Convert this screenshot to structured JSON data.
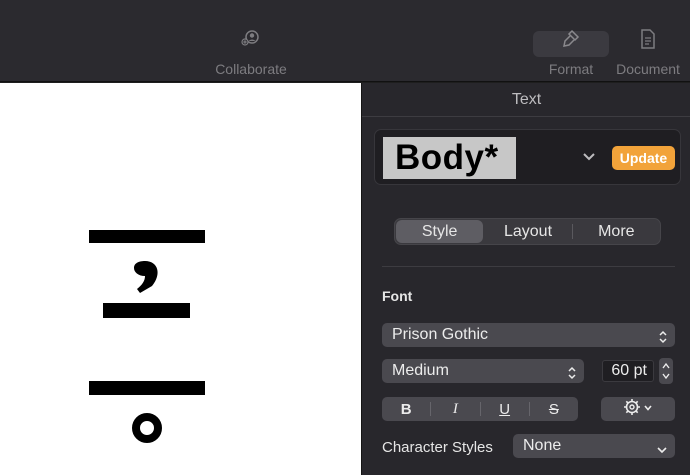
{
  "toolbar": {
    "collaborate_label": "Collaborate",
    "format_label": "Format",
    "document_label": "Document",
    "icons": [
      "collaborate-icon",
      "format-brush-icon",
      "document-icon"
    ]
  },
  "inspector": {
    "title": "Text",
    "paragraph_style": {
      "name": "Body*",
      "update_label": "Update"
    },
    "tabs": [
      {
        "label": "Style",
        "active": true
      },
      {
        "label": "Layout",
        "active": false
      },
      {
        "label": "More",
        "active": false
      }
    ],
    "font": {
      "header": "Font",
      "family": "Prison Gothic",
      "weight": "Medium",
      "size": "60 pt",
      "bold_label": "B",
      "italic_label": "I",
      "underline_label": "U",
      "strike_label": "S"
    },
    "character_styles": {
      "label": "Character Styles",
      "value": "None"
    }
  },
  "colors": {
    "accent_update": "#f2a33a",
    "panel_bg": "#28272c",
    "toolbar_bg": "#2b2a2f",
    "canvas_bg": "#ffffff"
  }
}
